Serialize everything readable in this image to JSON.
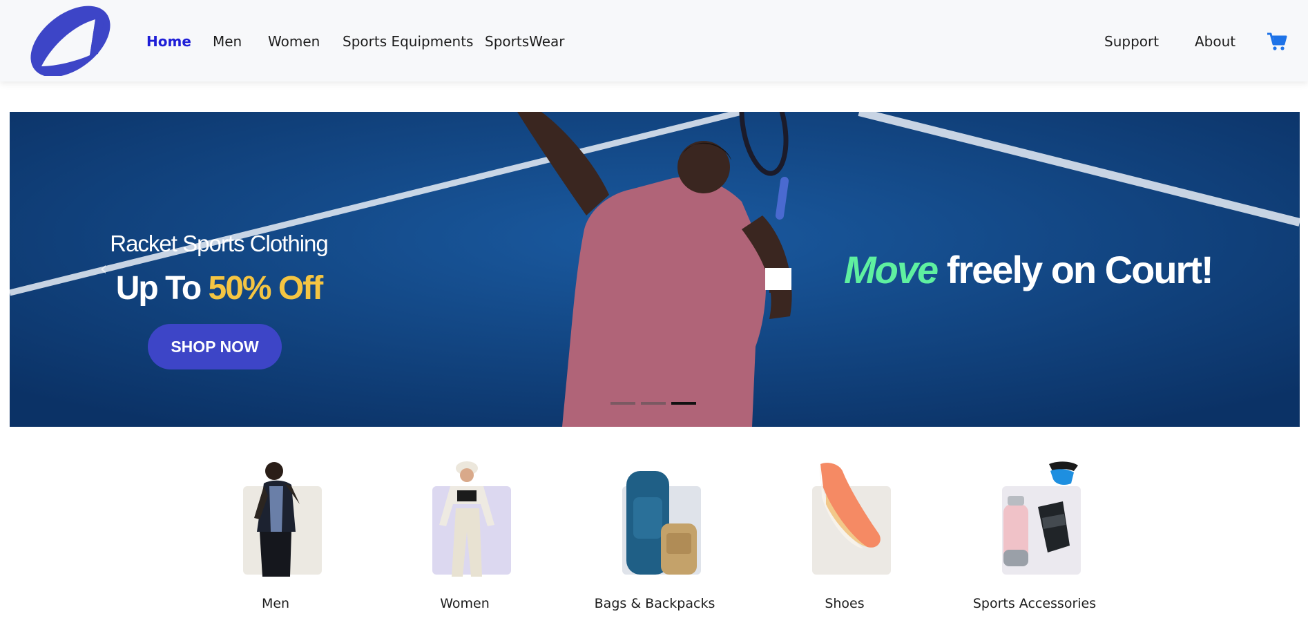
{
  "nav": {
    "links": [
      {
        "label": "Home",
        "active": true
      },
      {
        "label": "Men"
      },
      {
        "label": "Women"
      },
      {
        "label": "Sports Equipments"
      },
      {
        "label": "SportsWear"
      }
    ],
    "right_links": [
      {
        "label": "Support"
      },
      {
        "label": "About"
      }
    ],
    "active_color": "#1e1ed7",
    "cart_icon": "cart-icon"
  },
  "hero": {
    "heading": "Racket Sports Clothing",
    "offer_prefix": "Up To",
    "offer_highlight": "50% Off",
    "button_label": "SHOP NOW",
    "tagline_highlight": "Move",
    "tagline_rest": "freely on Court!",
    "slides_count": 3,
    "active_slide": 3
  },
  "categories": [
    {
      "label": "Men",
      "tile_color": "#ece9e2"
    },
    {
      "label": "Women",
      "tile_color": "#dcd8f0"
    },
    {
      "label": "Bags & Backpacks",
      "tile_color": "#dfe3ea"
    },
    {
      "label": "Shoes",
      "tile_color": "#ece9e4"
    },
    {
      "label": "Sports Accessories",
      "tile_color": "#ebe9ef"
    }
  ],
  "colors": {
    "brand": "#3d45c7",
    "hero_bg": "#0d3d76",
    "accent_yellow": "#f5c542",
    "accent_green": "#5ff0a0"
  }
}
